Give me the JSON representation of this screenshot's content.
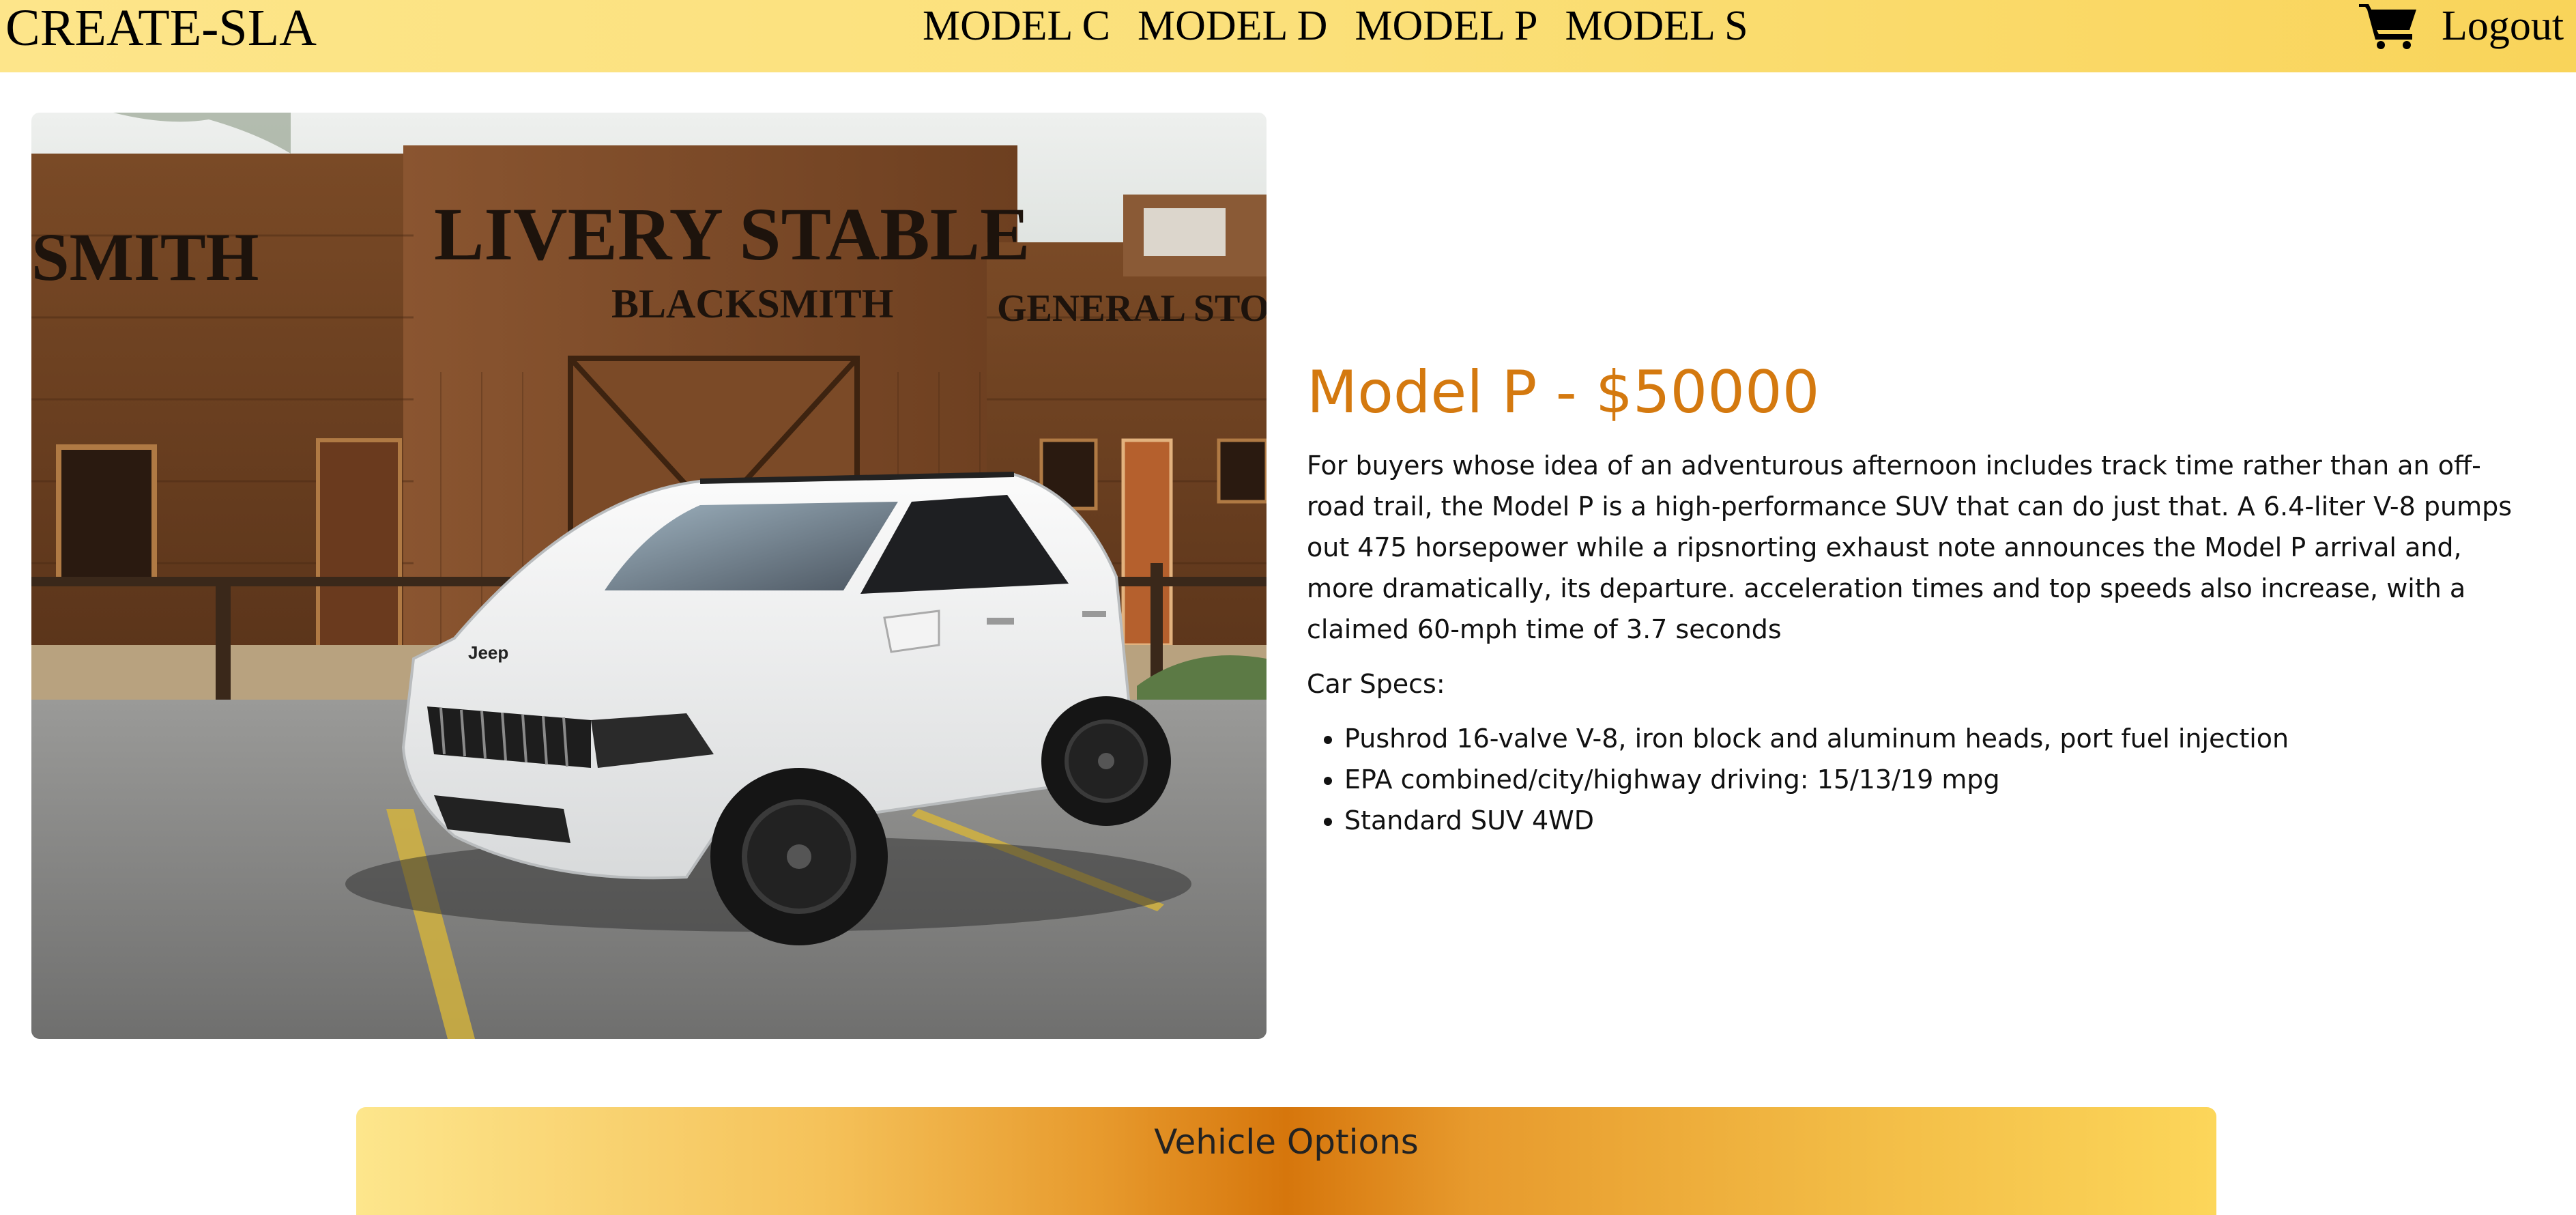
{
  "header": {
    "brand": "CREATE-SLA",
    "nav": [
      "MODEL C",
      "MODEL D",
      "MODEL P",
      "MODEL S"
    ],
    "cart_icon": "shopping-cart-icon",
    "logout_label": "Logout"
  },
  "product": {
    "title": "Model P - $50000",
    "description": "For buyers whose idea of an adventurous afternoon includes track time rather than an off-road trail, the Model P is a high-performance SUV that can do just that. A 6.4-liter V-8 pumps out 475 horsepower while a ripsnorting exhaust note announces the Model P arrival and, more dramatically, its departure. acceleration times and top speeds also increase, with a claimed 60-mph time of 3.7 seconds",
    "specs_label": "Car Specs:",
    "specs": [
      "Pushrod 16-valve V-8, iron block and aluminum heads, port fuel injection",
      "EPA combined/city/highway driving: 15/13/19 mpg",
      "Standard SUV 4WD"
    ],
    "image_signage": {
      "sign_main": "LIVERY STABLE",
      "sign_blacksmith": "BLACKSMITH",
      "sign_left": "SMITH",
      "sign_general": "GENERAL STO",
      "vehicle_badge": "Jeep"
    }
  },
  "options": {
    "title": "Vehicle Options"
  },
  "colors": {
    "accent": "#d4790f",
    "header_bg": "#fbe07a"
  }
}
